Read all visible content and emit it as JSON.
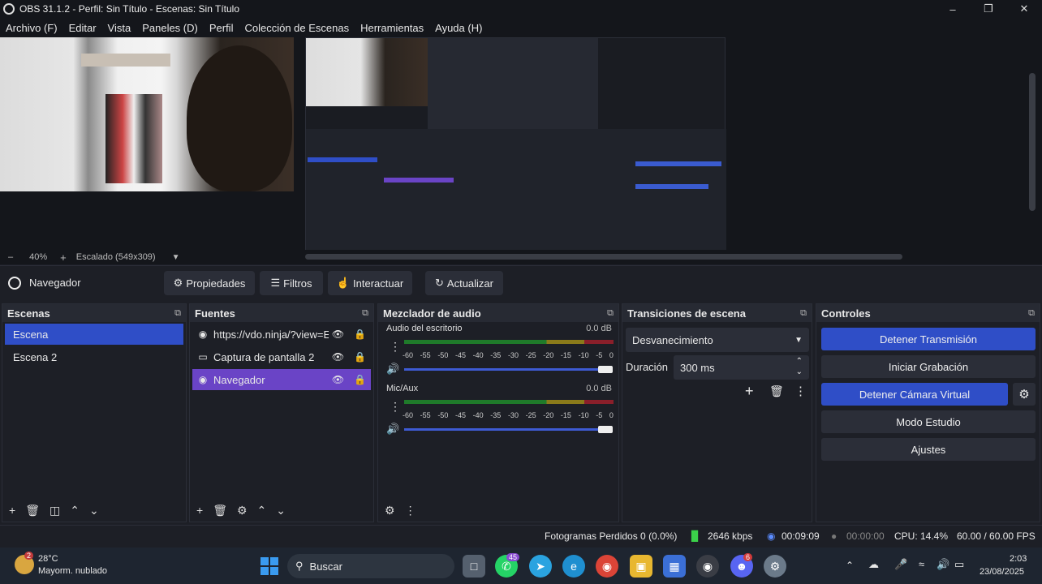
{
  "window": {
    "title": "OBS 31.1.2 - Perfil: Sin Título - Escenas: Sin Título"
  },
  "menu": [
    "Archivo (F)",
    "Editar",
    "Vista",
    "Paneles (D)",
    "Perfil",
    "Colección de Escenas",
    "Herramientas",
    "Ayuda (H)"
  ],
  "preview": {
    "zoom": "40%",
    "scale_label": "Escalado (549x309)"
  },
  "toolbar": {
    "source_name": "Navegador",
    "properties": "Propiedades",
    "filters": "Filtros",
    "interact": "Interactuar",
    "refresh": "Actualizar"
  },
  "scenes": {
    "title": "Escenas",
    "items": [
      "Escena",
      "Escena 2"
    ]
  },
  "sources": {
    "title": "Fuentes",
    "items": [
      "https://vdo.ninja/?view=E",
      "Captura de pantalla 2",
      "Navegador"
    ]
  },
  "mixer": {
    "title": "Mezclador de audio",
    "ticks": [
      "-60",
      "-55",
      "-50",
      "-45",
      "-40",
      "-35",
      "-30",
      "-25",
      "-20",
      "-15",
      "-10",
      "-5",
      "0"
    ],
    "channels": [
      {
        "name": "Audio del escritorio",
        "db": "0.0 dB"
      },
      {
        "name": "Mic/Aux",
        "db": "0.0 dB"
      }
    ]
  },
  "transitions": {
    "title": "Transiciones de escena",
    "selected": "Desvanecimiento",
    "duration_label": "Duración",
    "duration_value": "300 ms"
  },
  "controls": {
    "title": "Controles",
    "stop_stream": "Detener Transmisión",
    "start_record": "Iniciar Grabación",
    "stop_virtualcam": "Detener Cámara Virtual",
    "studio_mode": "Modo Estudio",
    "settings": "Ajustes"
  },
  "status": {
    "dropped": "Fotogramas Perdidos 0 (0.0%)",
    "bitrate": "2646 kbps",
    "stream_time": "00:09:09",
    "rec_time": "00:00:00",
    "cpu": "CPU: 14.4%",
    "fps": "60.00 / 60.00 FPS"
  },
  "taskbar": {
    "weather_temp": "28°C",
    "weather_desc": "Mayorm. nublado",
    "weather_badge": "2",
    "search": "Buscar",
    "whatsapp_badge": "45",
    "discord_badge": "6",
    "time": "2:03",
    "date": "23/08/2025"
  },
  "colors": {
    "accent_blue": "#2f4ec7",
    "accent_purple": "#6a44c6",
    "background": "#1d1f26"
  }
}
